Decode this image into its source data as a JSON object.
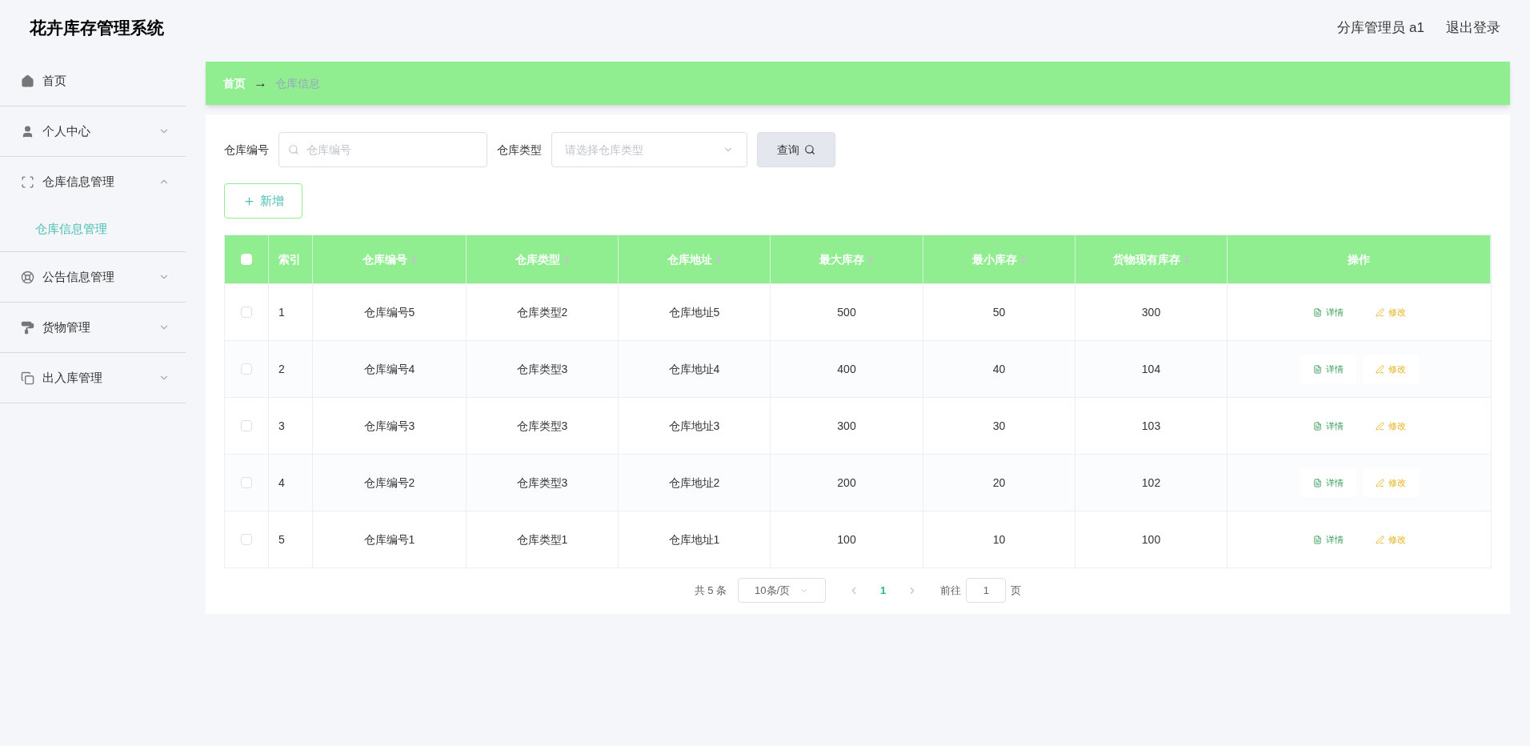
{
  "header": {
    "title": "花卉库存管理系统",
    "user": "分库管理员 a1",
    "logout": "退出登录"
  },
  "sidebar": {
    "items": [
      {
        "label": "首页"
      },
      {
        "label": "个人中心",
        "expanded": false
      },
      {
        "label": "仓库信息管理",
        "expanded": true,
        "children": [
          {
            "label": "仓库信息管理",
            "selected": true
          }
        ]
      },
      {
        "label": "公告信息管理",
        "expanded": false
      },
      {
        "label": "货物管理",
        "expanded": false
      },
      {
        "label": "出入库管理",
        "expanded": false
      }
    ]
  },
  "breadcrumb": {
    "home": "首页",
    "separator": "→",
    "current": "仓库信息"
  },
  "filters": {
    "code_label": "仓库编号",
    "code_placeholder": "仓库编号",
    "type_label": "仓库类型",
    "type_placeholder": "请选择仓库类型",
    "query": "查询"
  },
  "add_button": "新增",
  "table": {
    "select_all": {
      "checked": false
    },
    "columns": [
      {
        "label": "索引",
        "sortable": false
      },
      {
        "label": "仓库编号",
        "sortable": true
      },
      {
        "label": "仓库类型",
        "sortable": true
      },
      {
        "label": "仓库地址",
        "sortable": true
      },
      {
        "label": "最大库存",
        "sortable": true
      },
      {
        "label": "最小库存",
        "sortable": true
      },
      {
        "label": "货物现有库存",
        "sortable": true
      },
      {
        "label": "操作",
        "sortable": false
      }
    ],
    "rows": [
      {
        "checked": false,
        "cells": [
          "1",
          "仓库编号5",
          "仓库类型2",
          "仓库地址5",
          "500",
          "50",
          "300"
        ],
        "actions": [
          "详情",
          "修改"
        ]
      },
      {
        "checked": false,
        "cells": [
          "2",
          "仓库编号4",
          "仓库类型3",
          "仓库地址4",
          "400",
          "40",
          "104"
        ],
        "actions": [
          "详情",
          "修改"
        ]
      },
      {
        "checked": false,
        "cells": [
          "3",
          "仓库编号3",
          "仓库类型3",
          "仓库地址3",
          "300",
          "30",
          "103"
        ],
        "actions": [
          "详情",
          "修改"
        ]
      },
      {
        "checked": false,
        "cells": [
          "4",
          "仓库编号2",
          "仓库类型3",
          "仓库地址2",
          "200",
          "20",
          "102"
        ],
        "actions": [
          "详情",
          "修改"
        ]
      },
      {
        "checked": false,
        "cells": [
          "5",
          "仓库编号1",
          "仓库类型1",
          "仓库地址1",
          "100",
          "10",
          "100"
        ],
        "actions": [
          "详情",
          "修改"
        ]
      }
    ]
  },
  "pagination": {
    "total": "共 5 条",
    "page_size": "10条/页",
    "pages": [
      {
        "label": "1",
        "selected": true
      }
    ],
    "goto_label": "前往",
    "goto_value": "1",
    "goto_suffix": "页"
  }
}
